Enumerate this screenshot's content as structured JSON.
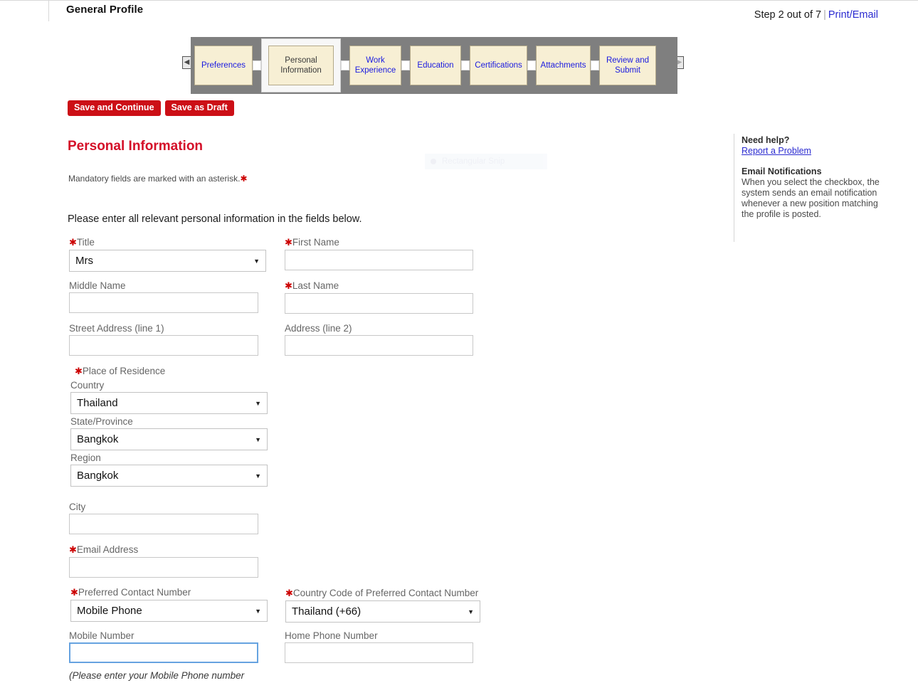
{
  "header": {
    "title": "General Profile",
    "step_text": "Step 2 out of 7",
    "separator": "|",
    "print_email_label": "Print/Email"
  },
  "stepbar": {
    "prev_arrow": "◀",
    "next_arrow": "▶",
    "tabs": [
      {
        "label": "Preferences",
        "active": false
      },
      {
        "label": "Personal Information",
        "active": true
      },
      {
        "label": "Work Experience",
        "active": false
      },
      {
        "label": "Education",
        "active": false
      },
      {
        "label": "Certifications",
        "active": false
      },
      {
        "label": "Attachments",
        "active": false
      },
      {
        "label": "Review and Submit",
        "active": false
      }
    ]
  },
  "actions": {
    "save_continue_label": "Save and Continue",
    "save_draft_label": "Save as Draft"
  },
  "section": {
    "title": "Personal Information",
    "mandatory_note": "Mandatory fields are marked with an asterisk.",
    "asterisk": "✱",
    "intro": "Please enter all relevant personal information in the fields below."
  },
  "snip_overlay": {
    "label": "Rectangular Snip"
  },
  "help": {
    "need_help_title": "Need help?",
    "report_problem_link": "Report a Problem",
    "email_notifications_title": "Email Notifications",
    "email_notifications_body": "When you select the checkbox, the system sends an email notification whenever a new position matching the profile is posted."
  },
  "form": {
    "title": {
      "label": "Title",
      "required": true,
      "value": "Mrs"
    },
    "first_name": {
      "label": "First Name",
      "required": true,
      "value": ""
    },
    "middle_name": {
      "label": "Middle Name",
      "required": false,
      "value": ""
    },
    "last_name": {
      "label": "Last Name",
      "required": true,
      "value": ""
    },
    "street_address_1": {
      "label": "Street Address (line 1)",
      "required": false,
      "value": ""
    },
    "address_2": {
      "label": "Address (line 2)",
      "required": false,
      "value": ""
    },
    "place_of_residence": {
      "label": "Place of Residence",
      "required": true
    },
    "country": {
      "label": "Country",
      "required": false,
      "value": "Thailand"
    },
    "state_province": {
      "label": "State/Province",
      "required": false,
      "value": "Bangkok"
    },
    "region": {
      "label": "Region",
      "required": false,
      "value": "Bangkok"
    },
    "city": {
      "label": "City",
      "required": false,
      "value": ""
    },
    "email_address": {
      "label": "Email Address",
      "required": true,
      "value": ""
    },
    "preferred_contact_number": {
      "label": "Preferred Contact Number",
      "required": true,
      "value": "Mobile Phone"
    },
    "country_code": {
      "label": "Country Code of Preferred Contact Number",
      "required": true,
      "value": "Thailand (+66)"
    },
    "mobile_number": {
      "label": "Mobile Number",
      "required": false,
      "value": "",
      "focused": true
    },
    "home_phone_number": {
      "label": "Home Phone Number",
      "required": false,
      "value": ""
    },
    "mobile_hint": "(Please enter your Mobile Phone number"
  },
  "colors": {
    "accent_red": "#cc0f16",
    "heading_red": "#d40f28",
    "link_blue": "#2a2ad0",
    "stepbar_gray": "#7f7f7f",
    "tab_cream": "#f7efd4",
    "focus_blue": "#66a3e0"
  }
}
